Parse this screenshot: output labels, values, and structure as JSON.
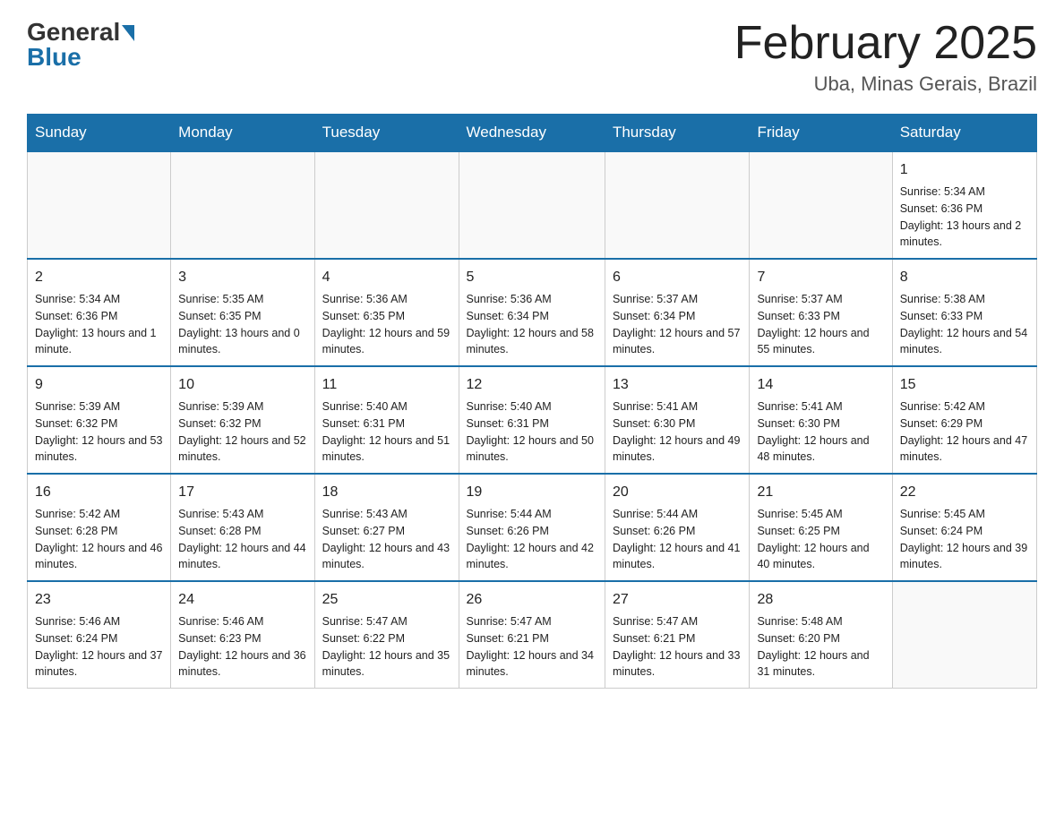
{
  "logo": {
    "general": "General",
    "blue": "Blue"
  },
  "title": "February 2025",
  "location": "Uba, Minas Gerais, Brazil",
  "days_of_week": [
    "Sunday",
    "Monday",
    "Tuesday",
    "Wednesday",
    "Thursday",
    "Friday",
    "Saturday"
  ],
  "weeks": [
    [
      {
        "day": "",
        "info": ""
      },
      {
        "day": "",
        "info": ""
      },
      {
        "day": "",
        "info": ""
      },
      {
        "day": "",
        "info": ""
      },
      {
        "day": "",
        "info": ""
      },
      {
        "day": "",
        "info": ""
      },
      {
        "day": "1",
        "info": "Sunrise: 5:34 AM\nSunset: 6:36 PM\nDaylight: 13 hours and 2 minutes."
      }
    ],
    [
      {
        "day": "2",
        "info": "Sunrise: 5:34 AM\nSunset: 6:36 PM\nDaylight: 13 hours and 1 minute."
      },
      {
        "day": "3",
        "info": "Sunrise: 5:35 AM\nSunset: 6:35 PM\nDaylight: 13 hours and 0 minutes."
      },
      {
        "day": "4",
        "info": "Sunrise: 5:36 AM\nSunset: 6:35 PM\nDaylight: 12 hours and 59 minutes."
      },
      {
        "day": "5",
        "info": "Sunrise: 5:36 AM\nSunset: 6:34 PM\nDaylight: 12 hours and 58 minutes."
      },
      {
        "day": "6",
        "info": "Sunrise: 5:37 AM\nSunset: 6:34 PM\nDaylight: 12 hours and 57 minutes."
      },
      {
        "day": "7",
        "info": "Sunrise: 5:37 AM\nSunset: 6:33 PM\nDaylight: 12 hours and 55 minutes."
      },
      {
        "day": "8",
        "info": "Sunrise: 5:38 AM\nSunset: 6:33 PM\nDaylight: 12 hours and 54 minutes."
      }
    ],
    [
      {
        "day": "9",
        "info": "Sunrise: 5:39 AM\nSunset: 6:32 PM\nDaylight: 12 hours and 53 minutes."
      },
      {
        "day": "10",
        "info": "Sunrise: 5:39 AM\nSunset: 6:32 PM\nDaylight: 12 hours and 52 minutes."
      },
      {
        "day": "11",
        "info": "Sunrise: 5:40 AM\nSunset: 6:31 PM\nDaylight: 12 hours and 51 minutes."
      },
      {
        "day": "12",
        "info": "Sunrise: 5:40 AM\nSunset: 6:31 PM\nDaylight: 12 hours and 50 minutes."
      },
      {
        "day": "13",
        "info": "Sunrise: 5:41 AM\nSunset: 6:30 PM\nDaylight: 12 hours and 49 minutes."
      },
      {
        "day": "14",
        "info": "Sunrise: 5:41 AM\nSunset: 6:30 PM\nDaylight: 12 hours and 48 minutes."
      },
      {
        "day": "15",
        "info": "Sunrise: 5:42 AM\nSunset: 6:29 PM\nDaylight: 12 hours and 47 minutes."
      }
    ],
    [
      {
        "day": "16",
        "info": "Sunrise: 5:42 AM\nSunset: 6:28 PM\nDaylight: 12 hours and 46 minutes."
      },
      {
        "day": "17",
        "info": "Sunrise: 5:43 AM\nSunset: 6:28 PM\nDaylight: 12 hours and 44 minutes."
      },
      {
        "day": "18",
        "info": "Sunrise: 5:43 AM\nSunset: 6:27 PM\nDaylight: 12 hours and 43 minutes."
      },
      {
        "day": "19",
        "info": "Sunrise: 5:44 AM\nSunset: 6:26 PM\nDaylight: 12 hours and 42 minutes."
      },
      {
        "day": "20",
        "info": "Sunrise: 5:44 AM\nSunset: 6:26 PM\nDaylight: 12 hours and 41 minutes."
      },
      {
        "day": "21",
        "info": "Sunrise: 5:45 AM\nSunset: 6:25 PM\nDaylight: 12 hours and 40 minutes."
      },
      {
        "day": "22",
        "info": "Sunrise: 5:45 AM\nSunset: 6:24 PM\nDaylight: 12 hours and 39 minutes."
      }
    ],
    [
      {
        "day": "23",
        "info": "Sunrise: 5:46 AM\nSunset: 6:24 PM\nDaylight: 12 hours and 37 minutes."
      },
      {
        "day": "24",
        "info": "Sunrise: 5:46 AM\nSunset: 6:23 PM\nDaylight: 12 hours and 36 minutes."
      },
      {
        "day": "25",
        "info": "Sunrise: 5:47 AM\nSunset: 6:22 PM\nDaylight: 12 hours and 35 minutes."
      },
      {
        "day": "26",
        "info": "Sunrise: 5:47 AM\nSunset: 6:21 PM\nDaylight: 12 hours and 34 minutes."
      },
      {
        "day": "27",
        "info": "Sunrise: 5:47 AM\nSunset: 6:21 PM\nDaylight: 12 hours and 33 minutes."
      },
      {
        "day": "28",
        "info": "Sunrise: 5:48 AM\nSunset: 6:20 PM\nDaylight: 12 hours and 31 minutes."
      },
      {
        "day": "",
        "info": ""
      }
    ]
  ]
}
